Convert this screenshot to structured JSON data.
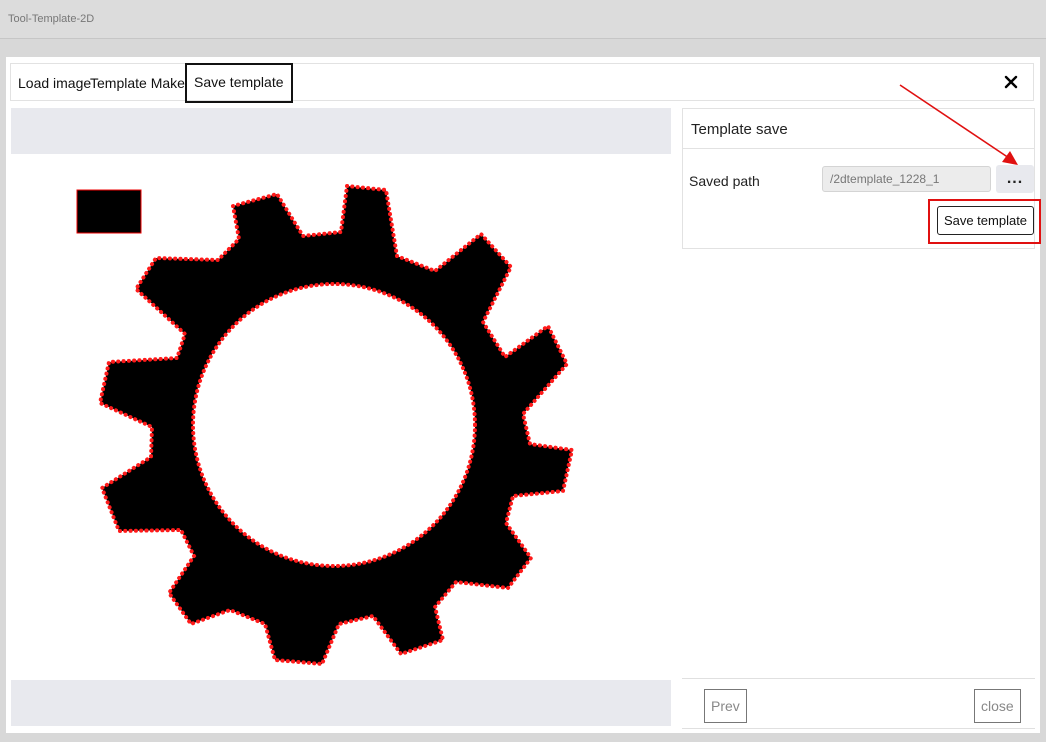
{
  "window": {
    "title": "Tool-Template-2D"
  },
  "tabs": [
    {
      "label": "Load image"
    },
    {
      "label": "Template Make"
    },
    {
      "label": "Save template"
    }
  ],
  "panel": {
    "title": "Template save",
    "saved_path_label": "Saved path",
    "saved_path_value": "/2dtemplate_1228_1",
    "browse_label": "...",
    "save_label": "Save template"
  },
  "footer": {
    "prev_label": "Prev",
    "close_label": "close"
  },
  "colors": {
    "contour": "#ff0000",
    "annotation": "#e01010",
    "gray_bar": "#e8e9ee"
  },
  "icons": {
    "close": "close-icon",
    "gear": "gear-shape"
  }
}
